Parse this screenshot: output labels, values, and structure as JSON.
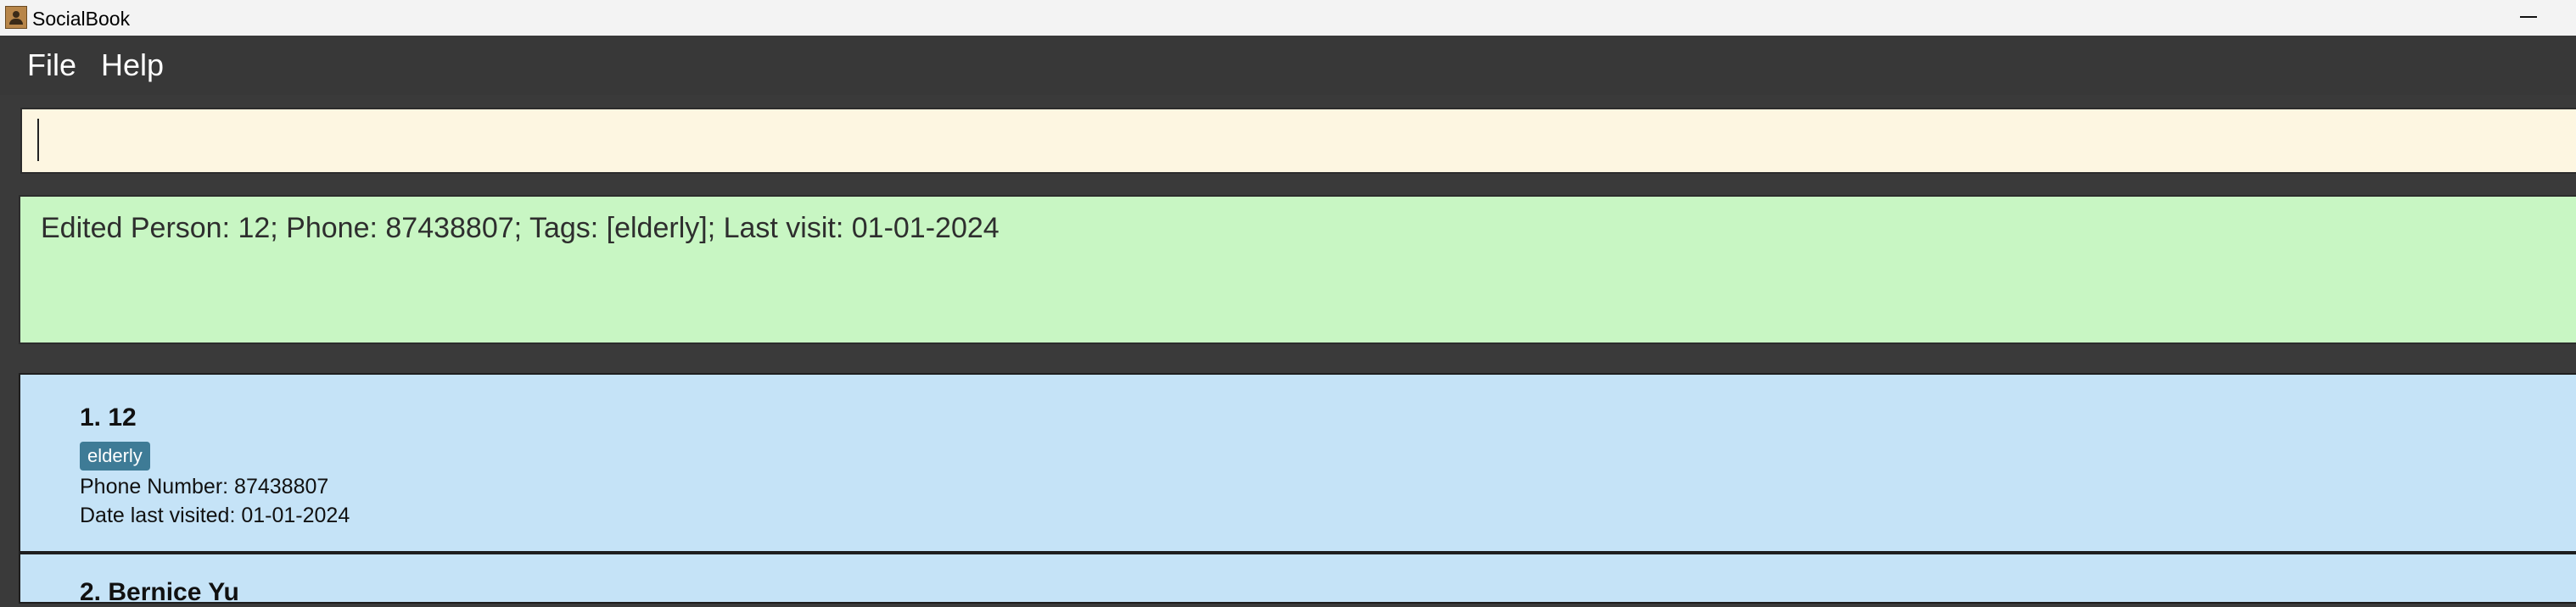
{
  "window": {
    "title": "SocialBook",
    "icon": "address-book-icon"
  },
  "menu": {
    "items": [
      "File",
      "Help"
    ]
  },
  "command_box": {
    "value": ""
  },
  "result": {
    "text": "Edited Person: 12; Phone: 87438807; Tags: [elderly]; Last visit: 01-01-2024"
  },
  "persons": [
    {
      "name": "1. 12",
      "tags": [
        "elderly"
      ],
      "phone": "Phone Number: 87438807",
      "last_visit": "Date last visited: 01-01-2024"
    },
    {
      "name": "2. Bernice Yu"
    }
  ],
  "colors": {
    "command_bg": "#fdf6e1",
    "result_bg": "#c8f6c3",
    "card_bg": "#c5e3f7",
    "tag_bg": "#3e7b96",
    "menubar_bg": "#383838"
  }
}
